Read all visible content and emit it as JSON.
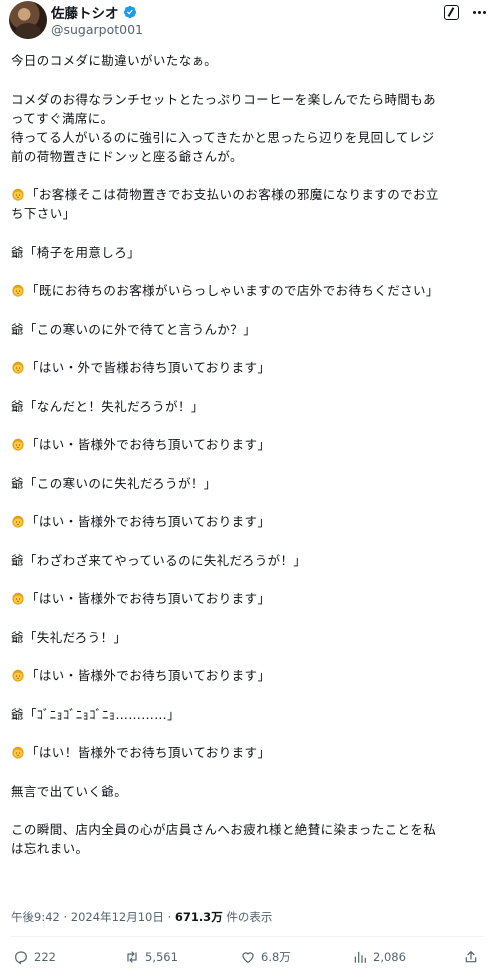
{
  "author": {
    "display_name": "佐藤トシオ",
    "handle": "@sugarpot001"
  },
  "post": {
    "paragraphs": [
      [
        "今日のコメダに勘違いがいたなぁ。"
      ],
      [
        "コメダのお得なランチセットとたっぷりコーヒーを楽しんでたら時間もあ",
        "ってすぐ満席に。",
        "待ってる人がいるのに強引に入ってきたかと思ったら辺りを見回してレジ",
        "前の荷物置きにドンッと座る爺さんが。"
      ],
      [
        "「お客様そこは荷物置きでお支払いのお客様の邪魔になりますのでお立",
        "ち下さい」"
      ],
      [
        "爺「椅子を用意しろ」"
      ],
      [
        "「既にお待ちのお客様がいらっしゃいますので店外でお待ちください」"
      ],
      [
        "爺「この寒いのに外で待てと言うんか？」"
      ],
      [
        "「はい・外で皆様お待ち頂いております」"
      ],
      [
        "爺「なんだと！失礼だろうが！」"
      ],
      [
        "「はい・皆様外でお待ち頂いております」"
      ],
      [
        "爺「この寒いのに失礼だろうが！」"
      ],
      [
        "「はい・皆様外でお待ち頂いております」"
      ],
      [
        "爺「わざわざ来てやっているのに失礼だろうが！」"
      ],
      [
        "「はい・皆様外でお待ち頂いております」"
      ],
      [
        "爺「失礼だろう！」"
      ],
      [
        "「はい・皆様外でお待ち頂いております」"
      ],
      [
        "爺「ｺﾞﾆｮｺﾞﾆｮｺﾞﾆｮ…………」"
      ],
      [
        "「はい！皆様外でお待ち頂いております」"
      ],
      [
        "無言で出ていく爺。"
      ],
      [
        "この瞬間、店内全員の心が店員さんへお疲れ様と絶賛に染まったことを私",
        "は忘れまい。"
      ]
    ],
    "emoji_name": "woman-emoji"
  },
  "meta": {
    "time": "午後9:42",
    "separator": "·",
    "date": "2024年12月10日",
    "views_count": "671.3万",
    "views_label": " 件の表示"
  },
  "actions": {
    "replies": "222",
    "reposts": "5,561",
    "likes": "6.8万",
    "views": "2,086"
  },
  "colors": {
    "verified": "#1d9bf0",
    "text": "#0f1419",
    "muted": "#536471",
    "emoji": "#ffc83d"
  }
}
